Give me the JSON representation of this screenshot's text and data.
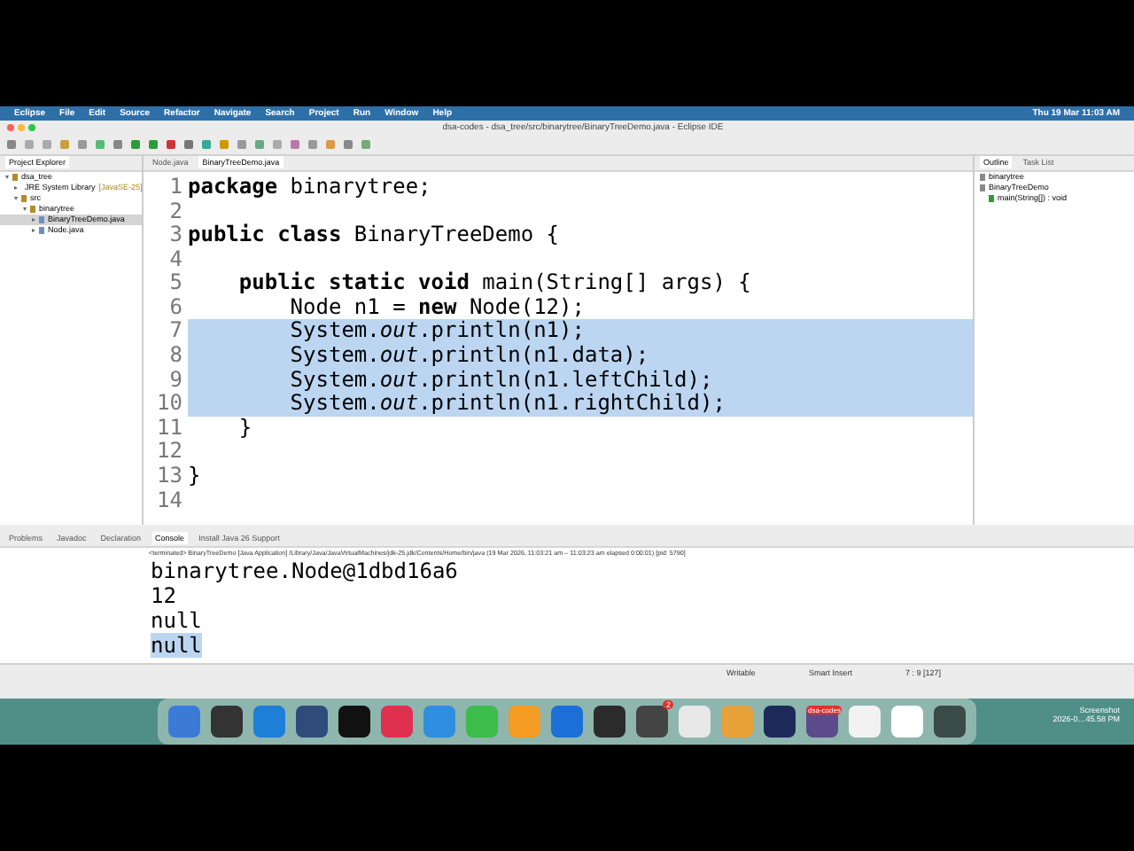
{
  "menu_bar": {
    "app": "Eclipse",
    "items": [
      "File",
      "Edit",
      "Source",
      "Refactor",
      "Navigate",
      "Search",
      "Project",
      "Run",
      "Window",
      "Help"
    ],
    "clock": "Thu 19 Mar  11:03 AM"
  },
  "window": {
    "title": "dsa-codes - dsa_tree/src/binarytree/BinaryTreeDemo.java - Eclipse IDE"
  },
  "project_explorer": {
    "tab": "Project Explorer",
    "tree": [
      {
        "label": "dsa_tree",
        "expanded": true,
        "selected": false,
        "children": [
          {
            "label": "JRE System Library",
            "suffix": "[JavaSE-25]",
            "expanded": false,
            "selected": false
          },
          {
            "label": "src",
            "expanded": true,
            "selected": false,
            "children": [
              {
                "label": "binarytree",
                "expanded": true,
                "selected": false,
                "children": [
                  {
                    "label": "BinaryTreeDemo.java",
                    "expanded": false,
                    "selected": true
                  },
                  {
                    "label": "Node.java",
                    "expanded": false,
                    "selected": false
                  }
                ]
              }
            ]
          }
        ]
      }
    ]
  },
  "editor": {
    "tabs": [
      {
        "label": "Node.java",
        "selected": false
      },
      {
        "label": "BinaryTreeDemo.java",
        "selected": true
      }
    ],
    "lines": [
      {
        "number": "1",
        "text": "**package** binarytree;",
        "selected": false
      },
      {
        "number": "2",
        "selected": false
      },
      {
        "number": "3",
        "text": "**public class** BinaryTreeDemo {",
        "selected": false
      },
      {
        "number": "4",
        "selected": false
      },
      {
        "number": "5",
        "text": "    **public static void** main(String[] args) {",
        "selected": false
      },
      {
        "number": "6",
        "text": "        Node n1 = **new** Node(12);",
        "selected": false
      },
      {
        "number": "7",
        "text": "        System.*out*.println(n1);",
        "selected": true
      },
      {
        "number": "8",
        "text": "        System.*out*.println(n1.data);",
        "selected": true
      },
      {
        "number": "9",
        "text": "        System.*out*.println(n1.leftChild);",
        "selected": true
      },
      {
        "number": "10",
        "text": "        System.*out*.println(n1.rightChild);",
        "selected": true
      },
      {
        "number": "11",
        "text": "    }",
        "selected": false
      },
      {
        "number": "12",
        "selected": false
      },
      {
        "number": "13",
        "text": "}",
        "selected": false
      },
      {
        "number": "14",
        "selected": false
      }
    ]
  },
  "outline": {
    "tabs": [
      {
        "label": "Outline",
        "selected": true
      },
      {
        "label": "Task List",
        "selected": false
      }
    ],
    "items": [
      {
        "label": "binarytree"
      },
      {
        "label": "BinaryTreeDemo",
        "children": [
          {
            "label": "main(String[]) : void"
          }
        ]
      }
    ]
  },
  "console": {
    "tabs": [
      {
        "label": "Problems",
        "selected": false
      },
      {
        "label": "Javadoc",
        "selected": false
      },
      {
        "label": "Declaration",
        "selected": false
      },
      {
        "label": "Console",
        "selected": true
      },
      {
        "label": "Install Java 26 Support",
        "selected": false
      }
    ],
    "header": "<terminated> BinaryTreeDemo [Java Application] /Library/Java/JavaVirtualMachines/jdk-25.jdk/Contents/Home/bin/java  (19 Mar 2026, 11:03:21 am – 11:03:23 am elapsed 0:00:01) [pid: 5790]",
    "output": [
      {
        "text": "binarytree.Node@1dbd16a6",
        "selected": false
      },
      {
        "text": "12",
        "selected": false
      },
      {
        "text": "null",
        "selected": false
      },
      {
        "text": "null",
        "selected": true
      }
    ]
  },
  "status_bar": {
    "mode": "Writable",
    "insert": "Smart Insert",
    "position": "7 : 9 [127]"
  },
  "dock": {
    "notification_badge": "2",
    "window_label": "dsa-codes"
  },
  "desktop": {
    "file_name": "Screenshot",
    "file_date": "2026-0…45.58 PM"
  }
}
